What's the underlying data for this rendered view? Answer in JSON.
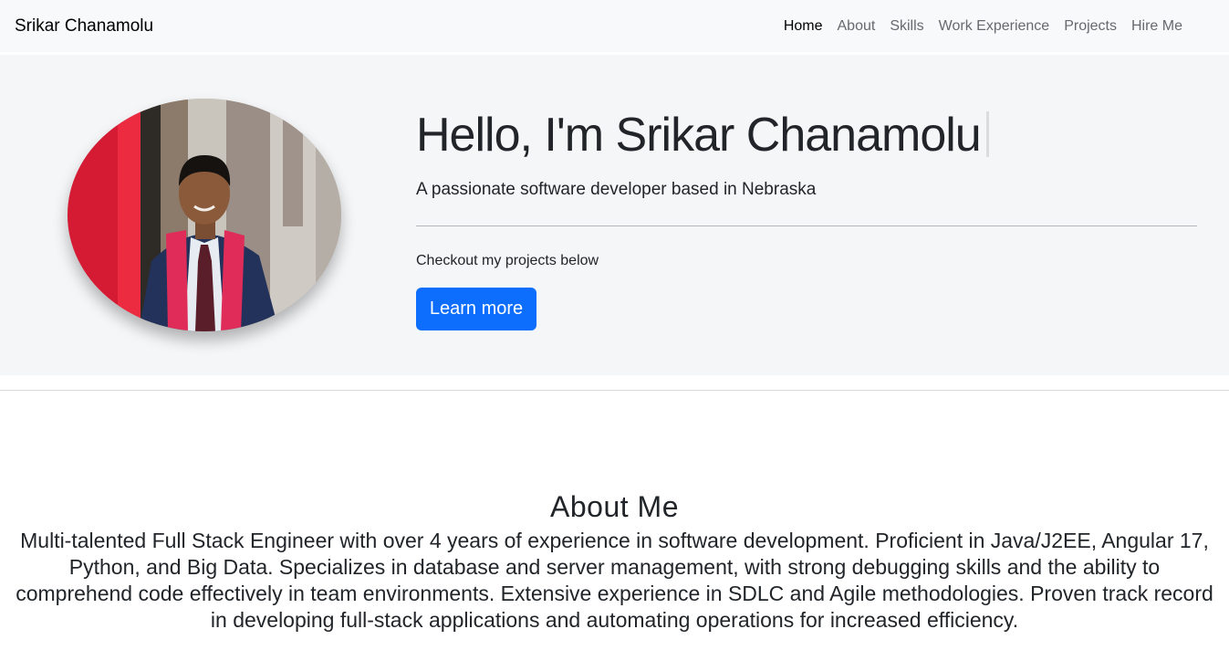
{
  "navbar": {
    "brand": "Srikar Chanamolu",
    "links": [
      {
        "label": "Home",
        "active": true
      },
      {
        "label": "About"
      },
      {
        "label": "Skills"
      },
      {
        "label": "Work Experience"
      },
      {
        "label": "Projects"
      },
      {
        "label": "Hire Me"
      }
    ]
  },
  "hero": {
    "title": "Hello, I'm Srikar Chanamolu",
    "subtitle": "A passionate software developer based in Nebraska",
    "note": "Checkout my projects below",
    "button_label": "Learn more"
  },
  "about": {
    "title": "About Me",
    "text": "Multi-talented Full Stack Engineer with over 4 years of experience in software development. Proficient in Java/J2EE, Angular 17, Python, and Big Data. Specializes in database and server management, with strong debugging skills and the ability to comprehend code effectively in team environments. Extensive experience in SDLC and Agile methodologies. Proven track record in developing full-stack applications and automating operations for increased efficiency."
  },
  "colors": {
    "navbar_bg": "#f8f9fa",
    "hero_bg": "#f5f6f8",
    "primary": "#0d6efd",
    "text": "#212529"
  }
}
